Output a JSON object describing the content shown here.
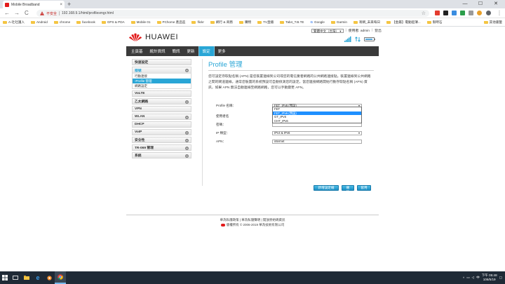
{
  "browser": {
    "tab_title": "Mobile Broadband",
    "tab_close": "×",
    "new_tab": "+",
    "window_controls": [
      "—",
      "☐",
      "✕"
    ],
    "nav_back": "←",
    "nav_forward": "→",
    "nav_reload": "C",
    "security_label": "不安全",
    "url": "192.168.9.1/html/profilesmgr.html",
    "bookmarks": [
      "A-社社護入",
      "Android",
      "chrome",
      "facebook",
      "GPS & PDA",
      "Mobile 01",
      "PChome 產品區",
      "flickr",
      "網行 & 商務",
      "購物",
      "TV直播",
      "Tab4_T.B.TE",
      "Google",
      "Garmin",
      "寄網_未來每日",
      "【金屬】電動超薄...",
      "限時石"
    ],
    "other_bookmarks": "其他書籤"
  },
  "router": {
    "brand": "HUAWEI",
    "language": "繁體中文（台灣）",
    "language_arrow": "▾",
    "username_label": "使用者: admin",
    "logout_label": "登出",
    "battery_level": 0.75,
    "nav": [
      {
        "label": "主頁基",
        "active": false
      },
      {
        "label": "統計資訊",
        "active": false
      },
      {
        "label": "簡訊",
        "active": false
      },
      {
        "label": "更新",
        "active": false
      },
      {
        "label": "設定",
        "active": true
      },
      {
        "label": "更多",
        "active": false
      }
    ],
    "sidebar": {
      "quick_setup": "快速設定",
      "dialup": {
        "title": "撥號",
        "items": [
          {
            "label": "行動連接",
            "selected": false
          },
          {
            "label": "›Profile 管理",
            "selected": true
          },
          {
            "label": "網路設定",
            "selected": false
          }
        ]
      },
      "sections": [
        "VoLTE",
        "乙太網路",
        "VPN",
        "WLAN",
        "DHCP",
        "VoIP",
        "安全性",
        "TR-069 管理",
        "系統"
      ],
      "expandable": [
        false,
        true,
        false,
        true,
        false,
        true,
        true,
        true,
        true
      ],
      "plus": "+"
    },
    "page_title": "Profile 管理",
    "description": "您可設定存取點名稱 (APN) 是您裝置連線到公司或您的電信業者網路的公共網路連接點。裝置連線到公共網路之間的閘道連線。通常您裝置的系統預設可自動偵測您的設定，當您連接網路開始行動存取點名稱 (APN) 資訊，如果 APN 無法自動連線至網路網路，您可以手動變更 APN。",
    "form": {
      "profile_label": "Profile 名稱：",
      "profile_value": "FET_IPv6 (預設)",
      "username_label": "使用者名",
      "password_label": "密碼：",
      "iptype_label": "IP 類型：",
      "iptype_value": "IPv4 & IPv6",
      "apn_label": "APN：",
      "apn_value": "internet",
      "arrow": "▾"
    },
    "dropdown_options": [
      {
        "label": "FET",
        "highlighted": false
      },
      {
        "label": "FET_IPv6 (預設)",
        "highlighted": true
      },
      {
        "label": "GT_IPv6",
        "highlighted": false
      },
      {
        "label": "CHT_IPv6",
        "highlighted": false
      }
    ],
    "buttons": {
      "new_profile": "新增設定檔",
      "delete": "刪除",
      "apply": "套用"
    },
    "footer": {
      "line1": "華為私隱政策 | 華為私隱聲明 | 開放原始碼資訊",
      "line2": "版權所有 © 2006-2019 華為技術有限公司"
    }
  },
  "taskbar": {
    "time": "下午 05:48",
    "date": "106/5/19",
    "tray_lang": "中"
  },
  "colors": {
    "accent": "#29a6d6",
    "nav_bg": "#3a3a3a",
    "brand_red": "#e21a1a",
    "taskbar": "#1f2a36"
  }
}
